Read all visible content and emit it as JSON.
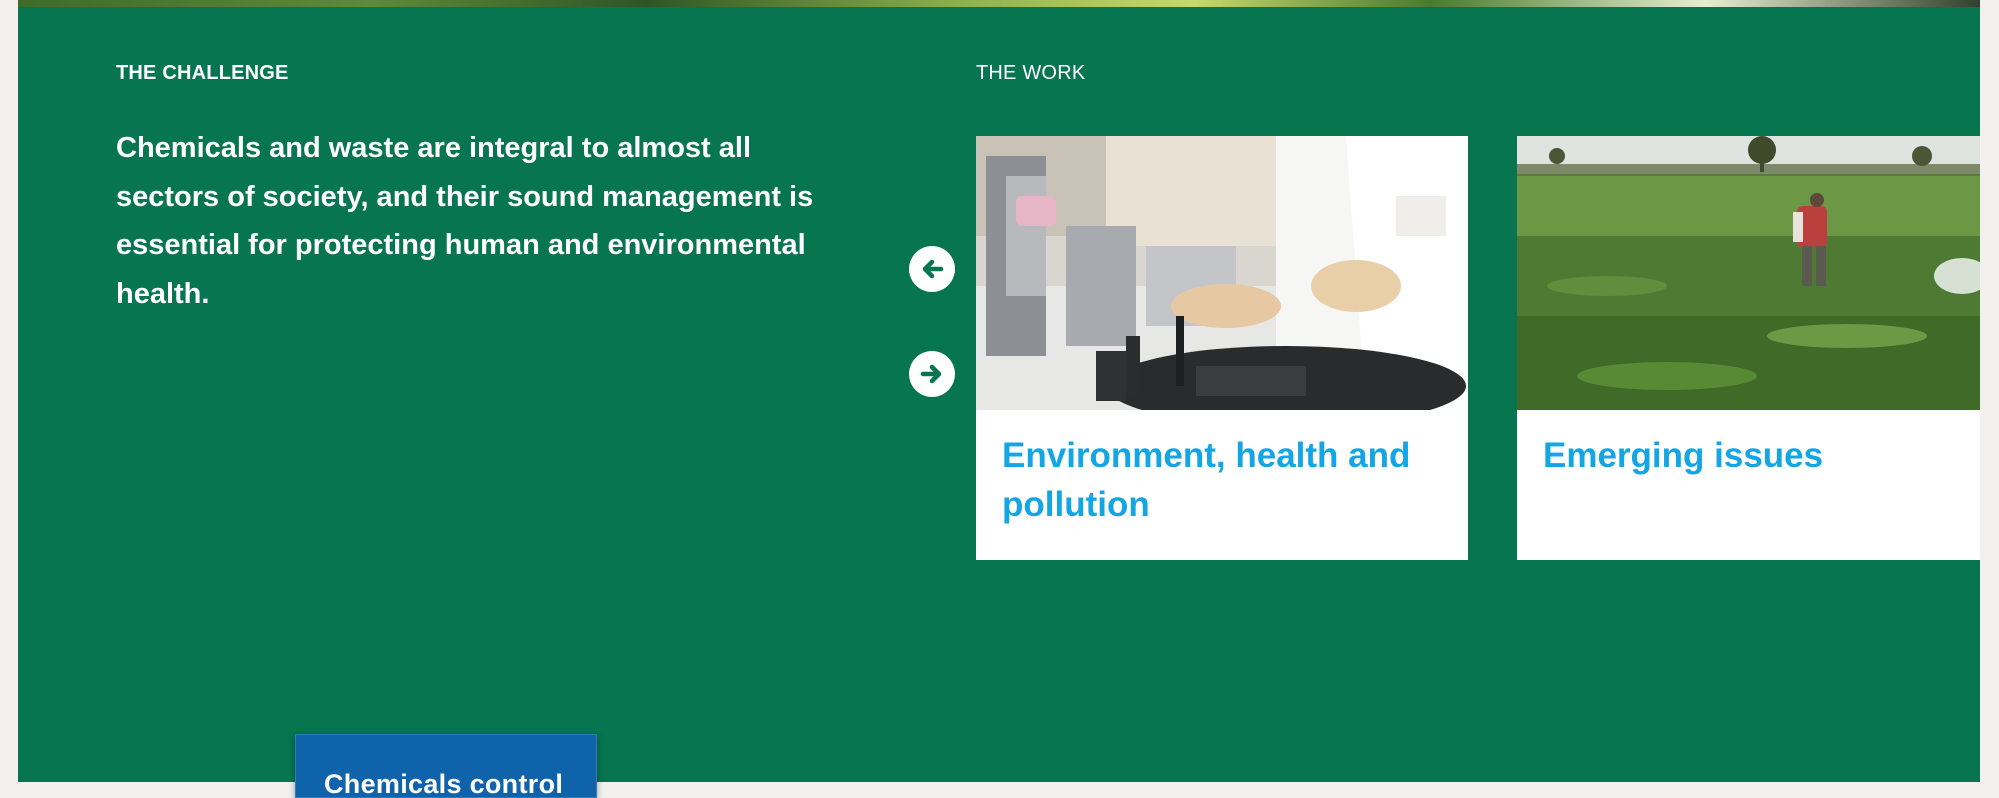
{
  "challenge": {
    "heading": "THE CHALLENGE",
    "text": "Chemicals and waste are integral to almost all sectors of society, and their sound management is essential for protecting human and environmental health."
  },
  "work": {
    "heading": "THE WORK",
    "cards": [
      {
        "title": "Environment, health and pollution",
        "image": "lab-scientist-photo"
      },
      {
        "title": "Emerging issues",
        "image": "field-pesticide-spraying-photo"
      }
    ]
  },
  "carousel": {
    "prev_icon": "arrow-left-circle-icon",
    "next_icon": "arrow-right-circle-icon"
  },
  "tag_button": {
    "label": "Chemicals control"
  },
  "colors": {
    "panel_bg": "#067550",
    "card_title": "#14a6e4",
    "tag_button_bg": "#0e63aa",
    "page_bg": "#f1f0ef"
  }
}
